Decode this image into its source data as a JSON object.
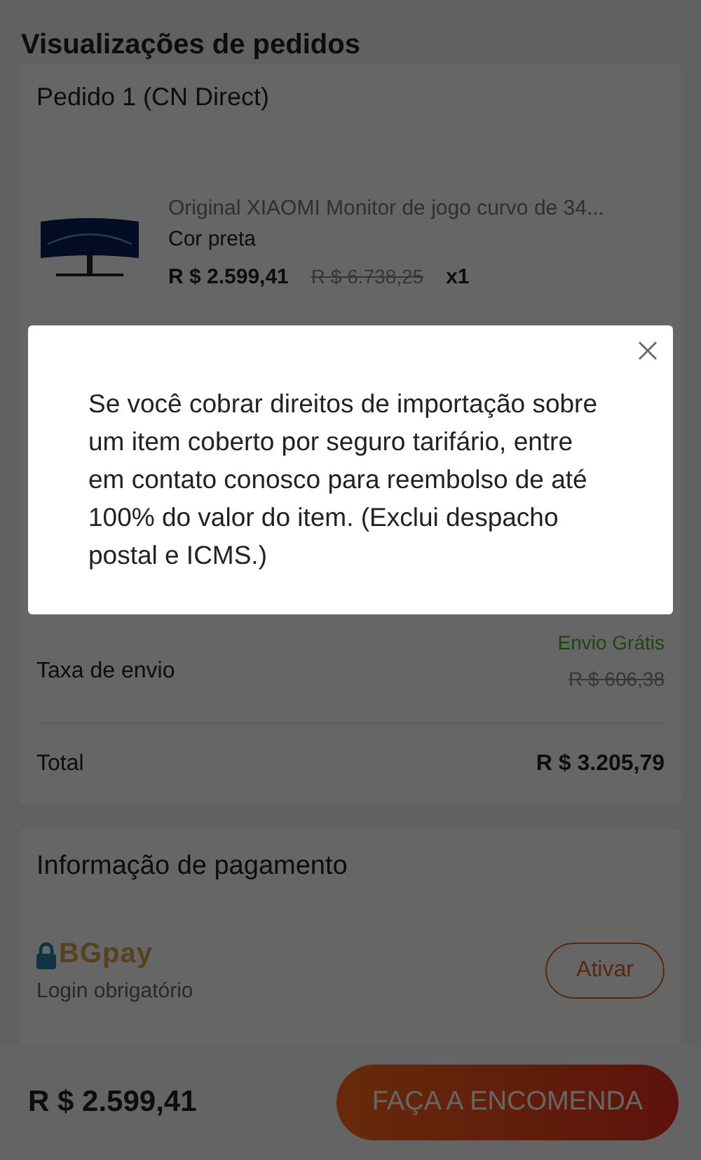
{
  "page_title": "Visualizações de pedidos",
  "order": {
    "title": "Pedido 1 (CN Direct)",
    "product": {
      "name": "Original XIAOMI Monitor de jogo curvo de 34...",
      "variant": "Cor preta",
      "price": "R $ 2.599,41",
      "original_price": "R $ 6.738,25",
      "quantity": "x1"
    },
    "shipping": {
      "label": "Taxa de envio",
      "free_label": "Envio Grátis",
      "original_price": "R $ 606,38"
    },
    "total": {
      "label": "Total",
      "value": "R $ 3.205,79"
    }
  },
  "payment": {
    "title": "Informação de pagamento",
    "brand": "BGpay",
    "note": "Login obrigatório",
    "button": "Ativar"
  },
  "bottom_bar": {
    "price": "R $ 2.599,41",
    "button": "FAÇA A ENCOMENDA"
  },
  "dialog": {
    "open": true,
    "message": "Se você cobrar direitos de importação sobre um item coberto por seguro tarifário, entre em contato conosco para reembolso de até 100% do valor do item. (Exclui despacho postal e ICMS.)"
  }
}
